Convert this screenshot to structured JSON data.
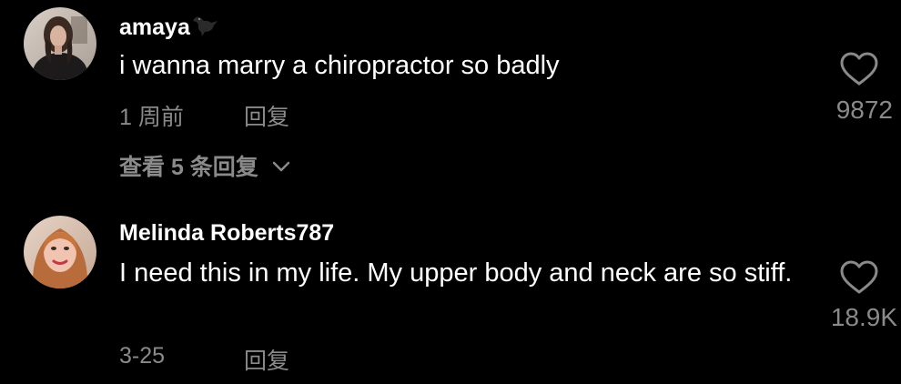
{
  "colors": {
    "background": "#000000",
    "primary_text": "#ffffff",
    "secondary_text": "#8a8a8a"
  },
  "comments": [
    {
      "username": "amaya",
      "username_emoji": "black-bird",
      "text": "i wanna marry a chiropractor so badly",
      "time": "1 周前",
      "reply_label": "回复",
      "like_icon": "heart-outline-icon",
      "like_count": "9872",
      "view_replies_label": "查看 5 条回复"
    },
    {
      "username": "Melinda Roberts787",
      "text": "I need this in my life. My upper body and neck are so stiff.",
      "time": "3-25",
      "reply_label": "回复",
      "like_icon": "heart-outline-icon",
      "like_count": "18.9K"
    }
  ]
}
